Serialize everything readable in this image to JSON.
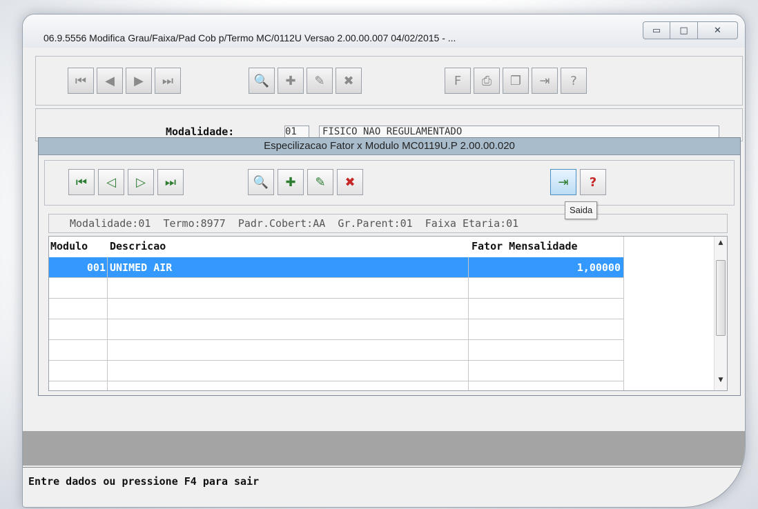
{
  "window": {
    "title": "06.9.5556 Modifica Grau/Faixa/Pad Cob p/Termo MC/0112U Versao 2.00.00.007 04/02/2015 - ..."
  },
  "header": {
    "modalidade_label": "Modalidade:",
    "modalidade_code": "01",
    "modalidade_desc": "FISICO NAO REGULAMENTADO"
  },
  "dialog": {
    "title": "Especilizacao Fator x Modulo MC0119U.P 2.00.00.020",
    "tooltip": "Saida",
    "info": "Modalidade:01  Termo:8977  Padr.Cobert:AA  Gr.Parent:01  Faixa Etaria:01",
    "columns": [
      "Modulo",
      "Descricao",
      "Fator Mensalidade"
    ],
    "rows": [
      {
        "modulo": "001",
        "descricao": "UNIMED AIR",
        "fator": "1,00000"
      }
    ]
  },
  "status": {
    "text": "Entre dados ou pressione F4 para sair"
  },
  "colors": {
    "selection": "#3399ff",
    "dialog_title_bg": "#a9bccc",
    "gray_band": "#a4a4a4"
  }
}
